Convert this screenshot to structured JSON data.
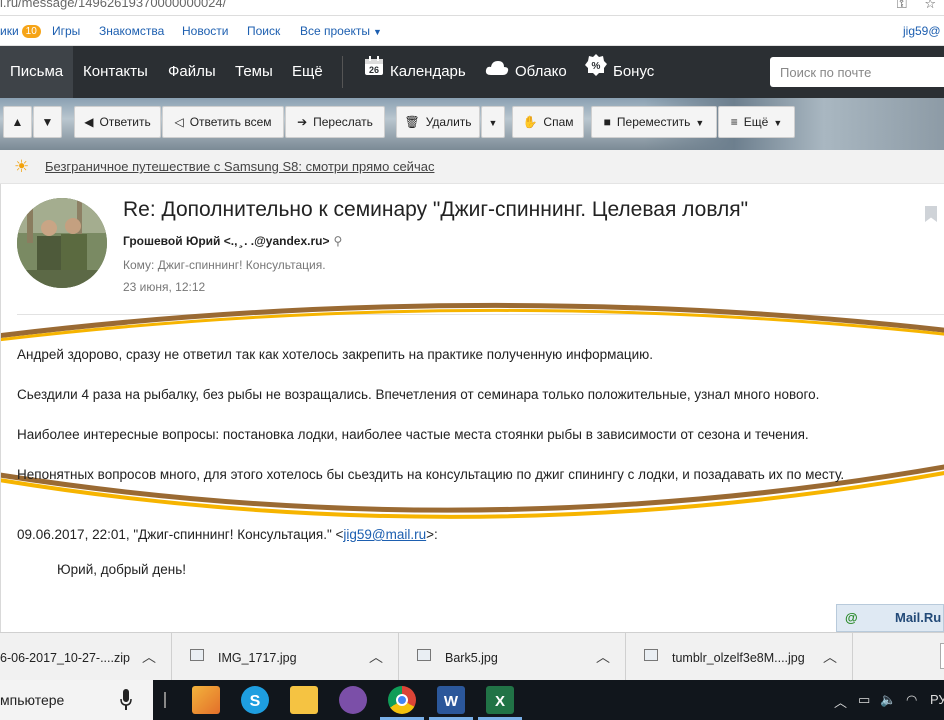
{
  "address": {
    "url": "i.ru/message/14962619370000000024/"
  },
  "projects": {
    "items": [
      {
        "label": "ики",
        "badge": "10"
      },
      {
        "label": "Игры"
      },
      {
        "label": "Знакомства"
      },
      {
        "label": "Новости"
      },
      {
        "label": "Поиск"
      },
      {
        "label": "Все проекты"
      }
    ],
    "user": "jig59@"
  },
  "nav": {
    "items": [
      "Письма",
      "Контакты",
      "Файлы",
      "Темы",
      "Ещё"
    ],
    "extras": [
      {
        "label": "Календарь",
        "icon": "calendar-icon",
        "day": "26"
      },
      {
        "label": "Облако",
        "icon": "cloud-icon"
      },
      {
        "label": "Бонус",
        "icon": "bonus-icon"
      }
    ],
    "search_placeholder": "Поиск по почте"
  },
  "toolbar": {
    "reply": "Ответить",
    "reply_all": "Ответить всем",
    "forward": "Переслать",
    "delete": "Удалить",
    "spam": "Спам",
    "move": "Переместить",
    "more": "Ещё"
  },
  "promo": {
    "text": "Безграничное путешествие с Samsung S8: смотри прямо сейчас"
  },
  "letter": {
    "subject": "Re: Дополнительно к семинару \"Джиг-спиннинг. Целевая ловля\"",
    "from": "Грошевой Юрий <.,  ̧ .  .@yandex.ru>",
    "to": "Кому: Джиг-спиннинг! Консультация.",
    "date": "23 июня, 12:12",
    "body": [
      "Андрей здорово, сразу не ответил так как хотелось закрепить на практике полученную информацию.",
      "Сьездили 4 раза на рыбалку, без рыбы не возращались. Впечетления от семинара только положительные, узнал много нового.",
      "Наиболее интересные вопросы: постановка лодки, наиболее частые места стоянки рыбы в зависимости от сезона и течения.",
      "Непонятных вопросов много, для этого хотелось бы сьездить на консультацию по джиг спинингу с лодки, и позадавать их по месту."
    ],
    "quote_prefix": "09.06.2017, 22:01, \"Джиг-спиннинг! Консультация.\" <",
    "quote_email": "jig59@mail.ru",
    "quote_suffix": ">:",
    "quote_body": "Юрий, добрый день!"
  },
  "widget": {
    "label": "Mail.Ru"
  },
  "downloads": [
    {
      "name": "6-06-2017_10-27-....zip"
    },
    {
      "name": "IMG_1717.jpg"
    },
    {
      "name": "Bark5.jpg"
    },
    {
      "name": "tumblr_olzelf3e8M....jpg"
    }
  ],
  "taskbar": {
    "search_text": "мпьютере",
    "apps": [
      "folder-app-icon",
      "skype-icon",
      "explorer-icon",
      "viber-icon",
      "chrome-icon",
      "word-icon",
      "excel-icon"
    ],
    "lang": "РУ"
  },
  "colors": {
    "nav_bg": "#2b2f33",
    "link": "#1d5fb0",
    "highlight": "#f6b400",
    "highlight_edge": "#9a6a33"
  }
}
